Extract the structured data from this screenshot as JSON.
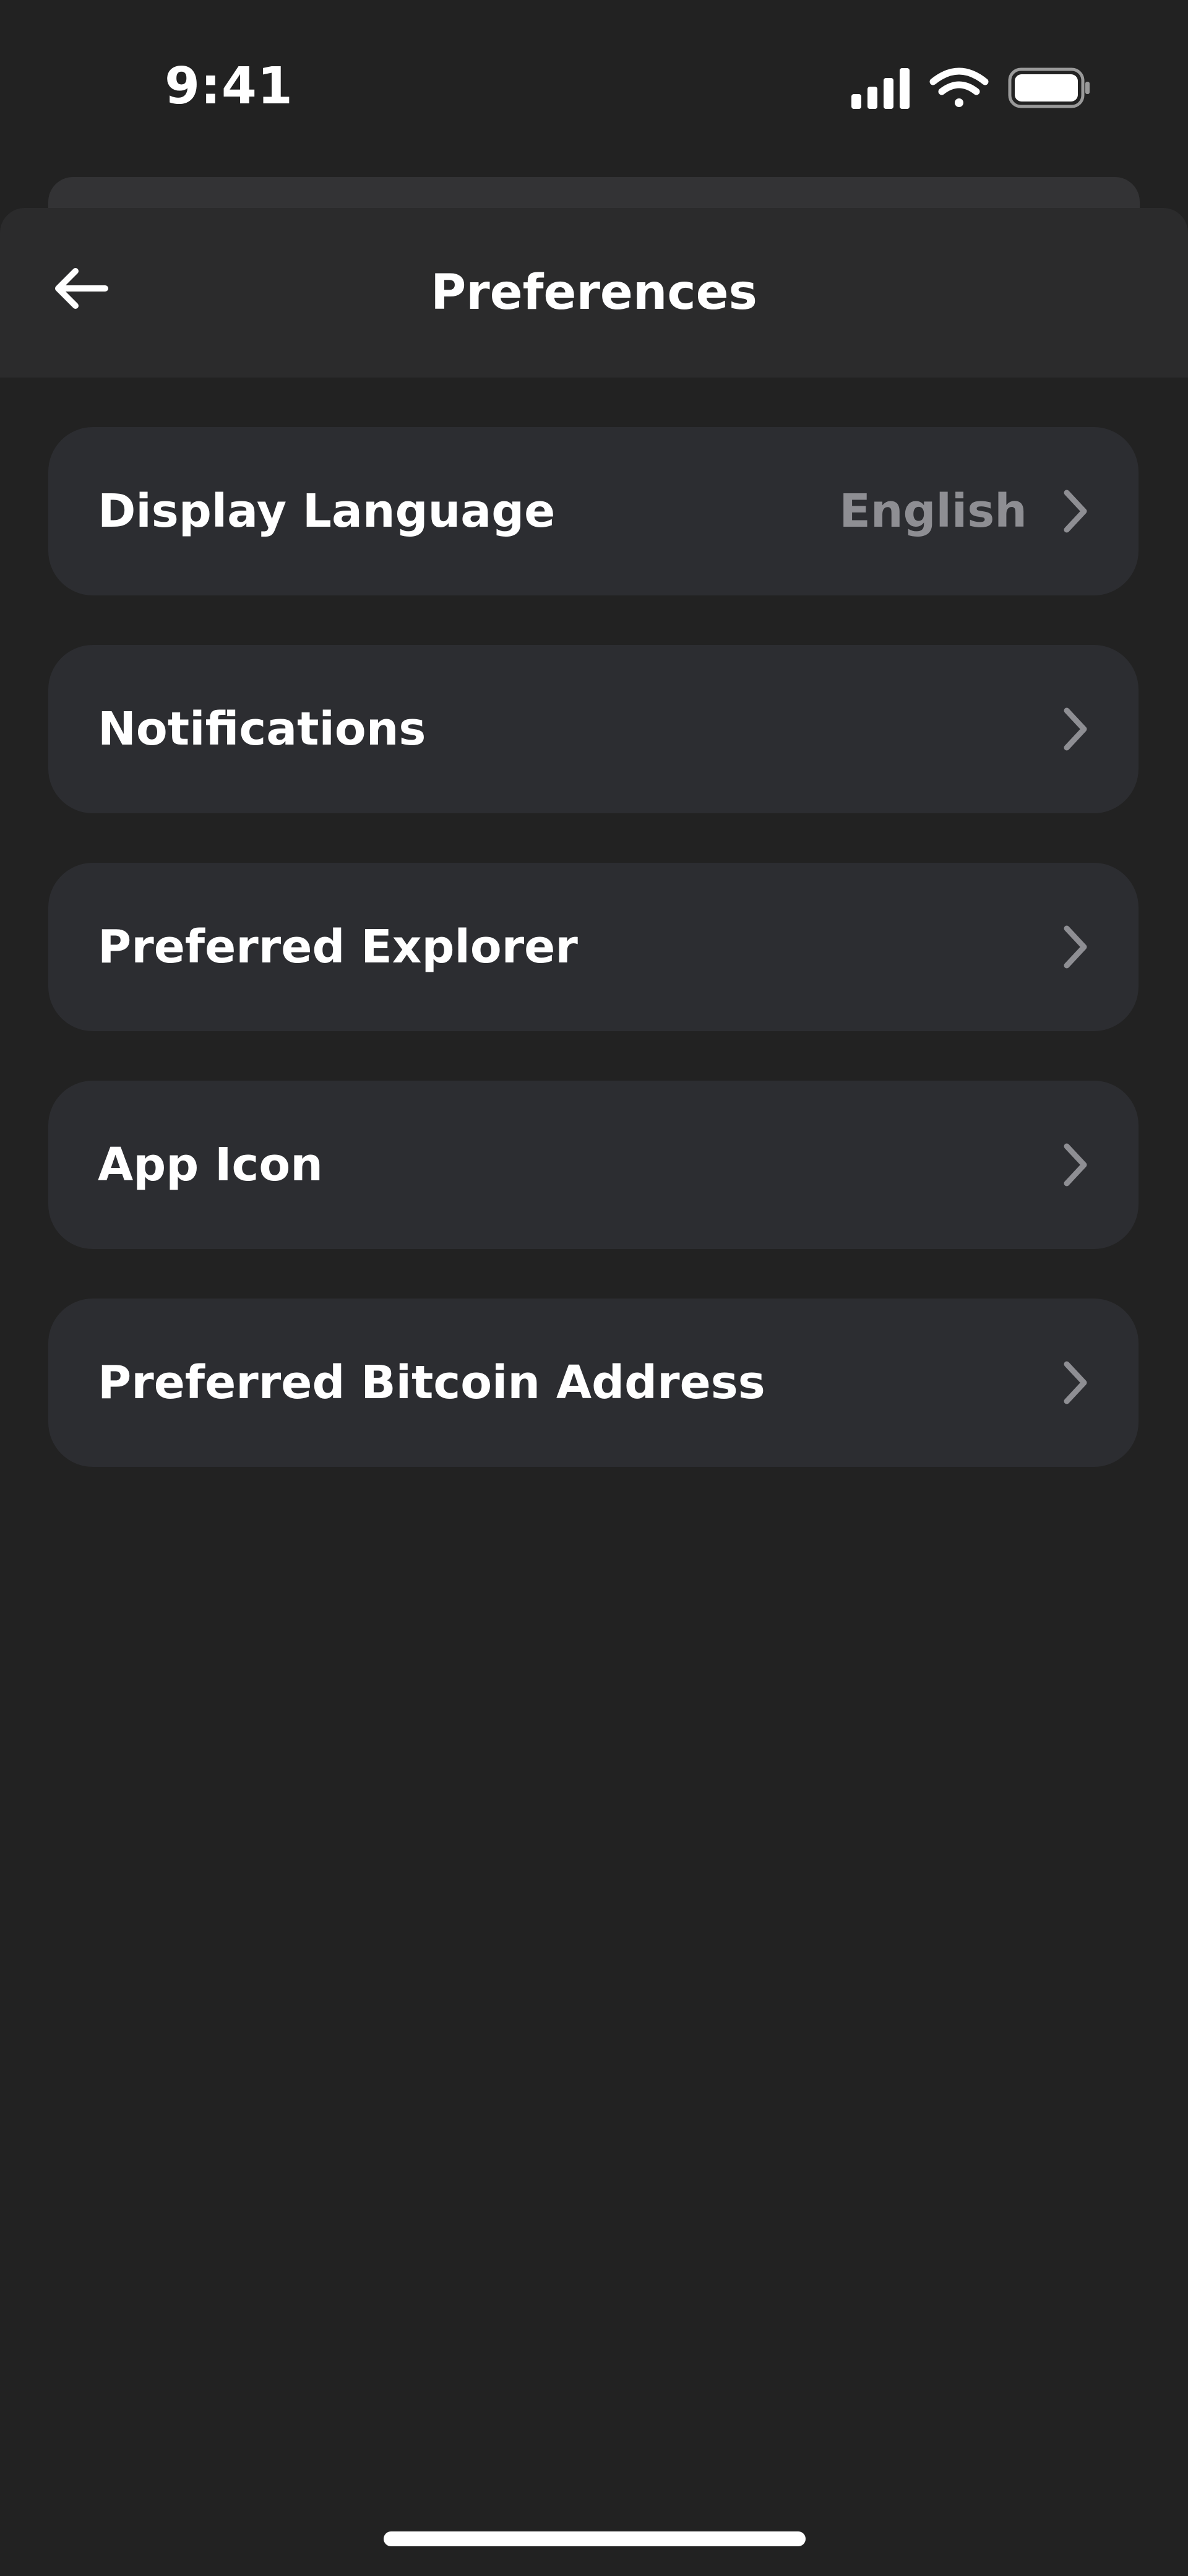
{
  "status_bar": {
    "time": "9:41",
    "icons": [
      "cellular-signal-icon",
      "wifi-icon",
      "battery-icon"
    ]
  },
  "header": {
    "title": "Preferences",
    "back_icon": "arrow-left-icon"
  },
  "settings": {
    "items": [
      {
        "label": "Display Language",
        "value": "English"
      },
      {
        "label": "Notifications",
        "value": ""
      },
      {
        "label": "Preferred Explorer",
        "value": ""
      },
      {
        "label": "App Icon",
        "value": ""
      },
      {
        "label": "Preferred Bitcoin Address",
        "value": ""
      }
    ]
  },
  "colors": {
    "background": "#222222",
    "header": "#2b2b2c",
    "row": "#2c2d31",
    "text_primary": "#ffffff",
    "text_secondary": "#8e8e93"
  }
}
